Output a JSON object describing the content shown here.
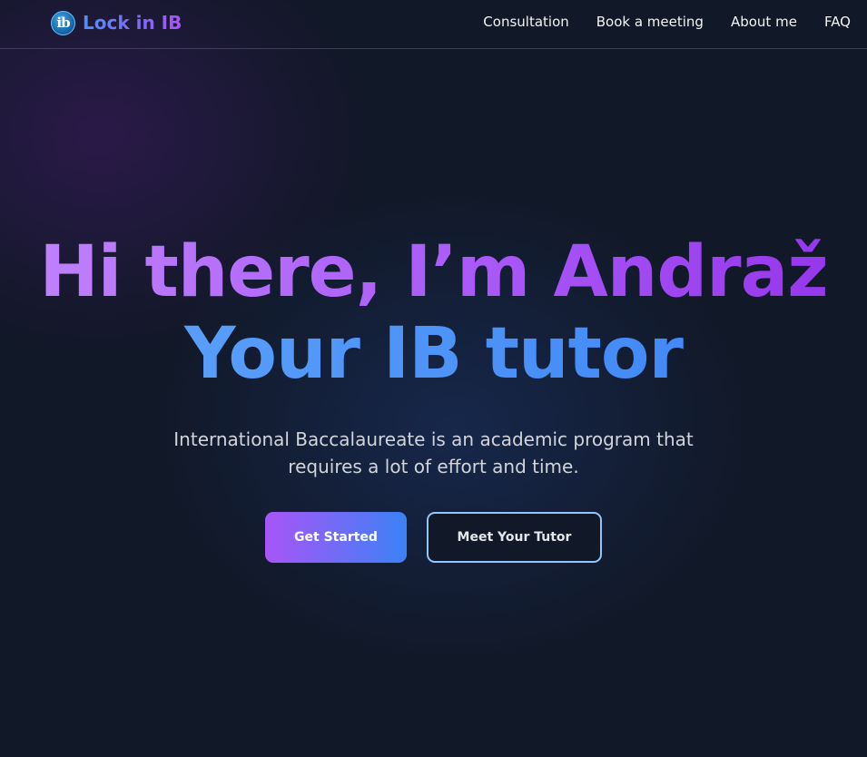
{
  "nav": {
    "logo_text": "ib",
    "brand": "Lock in IB",
    "links": [
      {
        "label": "Consultation"
      },
      {
        "label": "Book a meeting"
      },
      {
        "label": "About me"
      },
      {
        "label": "FAQ"
      }
    ]
  },
  "hero": {
    "title_line1": "Hi there, I’m Andraž",
    "title_line2": "Your IB tutor",
    "description": "International Baccalaureate is an academic program that requires a lot of effort and time.",
    "primary_button": "Get Started",
    "secondary_button": "Meet Your Tutor"
  },
  "colors": {
    "background": "#111827",
    "accent_purple": "#a855f7",
    "accent_blue": "#3b82f6"
  },
  "icons": {
    "logo": "ib-logo-icon"
  }
}
